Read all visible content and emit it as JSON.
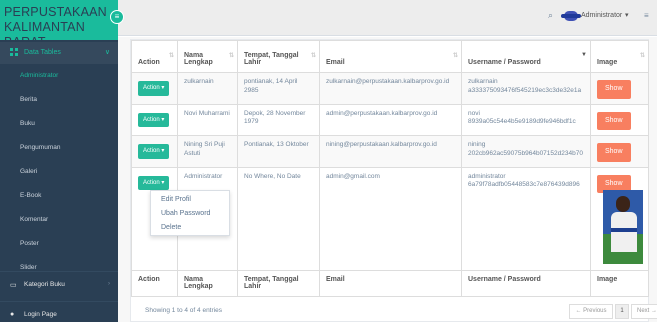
{
  "brand": {
    "title": "PERPUSTAKAAN\nKALIMANTAN BARAT",
    "toggle": "≡"
  },
  "sidebar": {
    "section": {
      "label": "Data Tables",
      "chevron": "∨"
    },
    "sub_items": [
      "Administrator",
      "Berita",
      "Buku",
      "Pengumuman",
      "Galeri",
      "E-Book",
      "Komentar",
      "Poster",
      "Slider"
    ],
    "active_index": 0,
    "items": [
      {
        "label": "Kategori Buku",
        "icon": "laptop-icon",
        "chevron": "›"
      },
      {
        "label": "Login Page",
        "icon": "user-icon"
      }
    ]
  },
  "topbar": {
    "user": "Administrator",
    "caret": "▾"
  },
  "table": {
    "headers": [
      "Action",
      "Nama Lengkap",
      "Tempat, Tanggal Lahir",
      "Email",
      "Username / Password",
      "Image"
    ],
    "footer_headers": [
      "Action",
      "Nama Lengkap",
      "Tempat, Tanggal Lahir",
      "Email",
      "Username / Password",
      "Image"
    ],
    "action_label": "Action ▾",
    "show_label": "Show",
    "rows": [
      {
        "nama": "zulkarnain",
        "ttl": "pontianak, 14 April 2985",
        "email": "zulkarnain@perpustakaan.kalbarprov.go.id",
        "user": "zulkarnain",
        "pass": "a333375093476f545219ec3c3de32e1a"
      },
      {
        "nama": "Novi Muharrami",
        "ttl": "Depok, 28 November 1979",
        "email": "admin@perpustakaan.kalbarprov.go.id",
        "user": "novi",
        "pass": "8939a05c54e4b5e9189d9fe946bdf1c"
      },
      {
        "nama": "Nining Sri Puji Astuti",
        "ttl": "Pontianak, 13 Oktober",
        "email": "nining@perpustakaan.kalbarprov.go.id",
        "user": "nining",
        "pass": "202cb962ac59075b964b07152d234b70"
      },
      {
        "nama": "Administrator",
        "ttl": "No Where, No Date",
        "email": "admin@gmail.com",
        "user": "administrator",
        "pass": "6a79f78adfb05448583c7e876439d896"
      }
    ]
  },
  "dropdown": [
    "Edit Profil",
    "Ubah Password",
    "Delete"
  ],
  "footer": {
    "info": "Showing 1 to 4 of 4 entries",
    "prev": "← Previous",
    "page": "1",
    "next": "Next →"
  }
}
